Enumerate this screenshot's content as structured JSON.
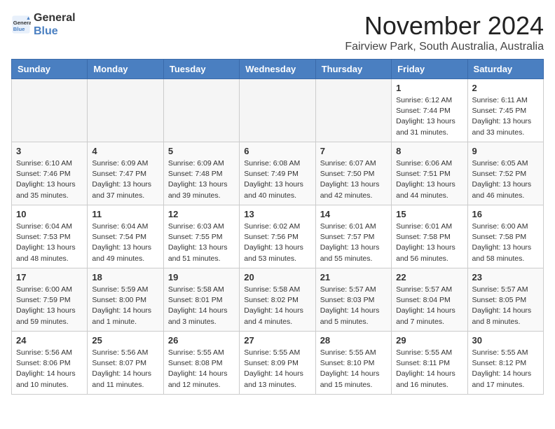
{
  "header": {
    "logo_line1": "General",
    "logo_line2": "Blue",
    "month_year": "November 2024",
    "location": "Fairview Park, South Australia, Australia"
  },
  "weekdays": [
    "Sunday",
    "Monday",
    "Tuesday",
    "Wednesday",
    "Thursday",
    "Friday",
    "Saturday"
  ],
  "weeks": [
    [
      {
        "day": "",
        "info": ""
      },
      {
        "day": "",
        "info": ""
      },
      {
        "day": "",
        "info": ""
      },
      {
        "day": "",
        "info": ""
      },
      {
        "day": "",
        "info": ""
      },
      {
        "day": "1",
        "info": "Sunrise: 6:12 AM\nSunset: 7:44 PM\nDaylight: 13 hours and 31 minutes."
      },
      {
        "day": "2",
        "info": "Sunrise: 6:11 AM\nSunset: 7:45 PM\nDaylight: 13 hours and 33 minutes."
      }
    ],
    [
      {
        "day": "3",
        "info": "Sunrise: 6:10 AM\nSunset: 7:46 PM\nDaylight: 13 hours and 35 minutes."
      },
      {
        "day": "4",
        "info": "Sunrise: 6:09 AM\nSunset: 7:47 PM\nDaylight: 13 hours and 37 minutes."
      },
      {
        "day": "5",
        "info": "Sunrise: 6:09 AM\nSunset: 7:48 PM\nDaylight: 13 hours and 39 minutes."
      },
      {
        "day": "6",
        "info": "Sunrise: 6:08 AM\nSunset: 7:49 PM\nDaylight: 13 hours and 40 minutes."
      },
      {
        "day": "7",
        "info": "Sunrise: 6:07 AM\nSunset: 7:50 PM\nDaylight: 13 hours and 42 minutes."
      },
      {
        "day": "8",
        "info": "Sunrise: 6:06 AM\nSunset: 7:51 PM\nDaylight: 13 hours and 44 minutes."
      },
      {
        "day": "9",
        "info": "Sunrise: 6:05 AM\nSunset: 7:52 PM\nDaylight: 13 hours and 46 minutes."
      }
    ],
    [
      {
        "day": "10",
        "info": "Sunrise: 6:04 AM\nSunset: 7:53 PM\nDaylight: 13 hours and 48 minutes."
      },
      {
        "day": "11",
        "info": "Sunrise: 6:04 AM\nSunset: 7:54 PM\nDaylight: 13 hours and 49 minutes."
      },
      {
        "day": "12",
        "info": "Sunrise: 6:03 AM\nSunset: 7:55 PM\nDaylight: 13 hours and 51 minutes."
      },
      {
        "day": "13",
        "info": "Sunrise: 6:02 AM\nSunset: 7:56 PM\nDaylight: 13 hours and 53 minutes."
      },
      {
        "day": "14",
        "info": "Sunrise: 6:01 AM\nSunset: 7:57 PM\nDaylight: 13 hours and 55 minutes."
      },
      {
        "day": "15",
        "info": "Sunrise: 6:01 AM\nSunset: 7:58 PM\nDaylight: 13 hours and 56 minutes."
      },
      {
        "day": "16",
        "info": "Sunrise: 6:00 AM\nSunset: 7:58 PM\nDaylight: 13 hours and 58 minutes."
      }
    ],
    [
      {
        "day": "17",
        "info": "Sunrise: 6:00 AM\nSunset: 7:59 PM\nDaylight: 13 hours and 59 minutes."
      },
      {
        "day": "18",
        "info": "Sunrise: 5:59 AM\nSunset: 8:00 PM\nDaylight: 14 hours and 1 minute."
      },
      {
        "day": "19",
        "info": "Sunrise: 5:58 AM\nSunset: 8:01 PM\nDaylight: 14 hours and 3 minutes."
      },
      {
        "day": "20",
        "info": "Sunrise: 5:58 AM\nSunset: 8:02 PM\nDaylight: 14 hours and 4 minutes."
      },
      {
        "day": "21",
        "info": "Sunrise: 5:57 AM\nSunset: 8:03 PM\nDaylight: 14 hours and 5 minutes."
      },
      {
        "day": "22",
        "info": "Sunrise: 5:57 AM\nSunset: 8:04 PM\nDaylight: 14 hours and 7 minutes."
      },
      {
        "day": "23",
        "info": "Sunrise: 5:57 AM\nSunset: 8:05 PM\nDaylight: 14 hours and 8 minutes."
      }
    ],
    [
      {
        "day": "24",
        "info": "Sunrise: 5:56 AM\nSunset: 8:06 PM\nDaylight: 14 hours and 10 minutes."
      },
      {
        "day": "25",
        "info": "Sunrise: 5:56 AM\nSunset: 8:07 PM\nDaylight: 14 hours and 11 minutes."
      },
      {
        "day": "26",
        "info": "Sunrise: 5:55 AM\nSunset: 8:08 PM\nDaylight: 14 hours and 12 minutes."
      },
      {
        "day": "27",
        "info": "Sunrise: 5:55 AM\nSunset: 8:09 PM\nDaylight: 14 hours and 13 minutes."
      },
      {
        "day": "28",
        "info": "Sunrise: 5:55 AM\nSunset: 8:10 PM\nDaylight: 14 hours and 15 minutes."
      },
      {
        "day": "29",
        "info": "Sunrise: 5:55 AM\nSunset: 8:11 PM\nDaylight: 14 hours and 16 minutes."
      },
      {
        "day": "30",
        "info": "Sunrise: 5:55 AM\nSunset: 8:12 PM\nDaylight: 14 hours and 17 minutes."
      }
    ]
  ]
}
